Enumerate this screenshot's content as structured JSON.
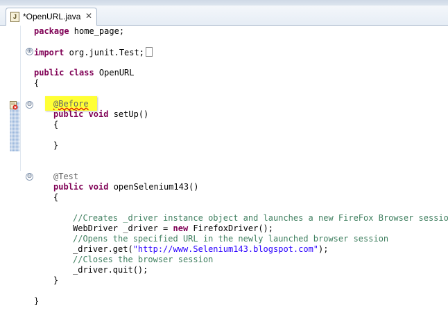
{
  "tab": {
    "title": "*OpenURL.java",
    "file_icon": "J",
    "close_icon": "✕"
  },
  "code": {
    "package": {
      "kw": "package",
      "rest": " home_page;"
    },
    "import": {
      "kw": "import",
      "rest": " org.junit.Test;"
    },
    "class_decl": {
      "kw": "public class",
      "rest": " OpenURL"
    },
    "open_brace": "{",
    "before_anno": "@Before",
    "setup_decl": {
      "kw": "public void",
      "rest": " setUp()"
    },
    "setup_open": "{",
    "setup_close": "}",
    "test_anno": "@Test",
    "test_decl": {
      "kw": "public void",
      "rest": " openSelenium143()"
    },
    "test_open": "{",
    "comment1": "//Creates _driver instance object and launches a new FireFox Browser session",
    "webdriver": {
      "pre": "WebDriver _driver = ",
      "kw": "new",
      "post": " FirefoxDriver();"
    },
    "comment2": "//Opens the specified URL in the newly launched browser session",
    "get": {
      "pre": "_driver.get(",
      "str": "\"http://www.Selenium143.blogspot.com\"",
      "post": ");"
    },
    "comment3": "//Closes the browser session",
    "quit": "_driver.quit();",
    "test_close": "}",
    "class_close": "}"
  },
  "fold_icons": {
    "expand": "⊕",
    "collapse": "⊖"
  },
  "colors": {
    "keyword": "#7f0055",
    "comment": "#3f7f5f",
    "string": "#2a00ff",
    "annotation": "#646464",
    "highlight": "#ffff35"
  }
}
